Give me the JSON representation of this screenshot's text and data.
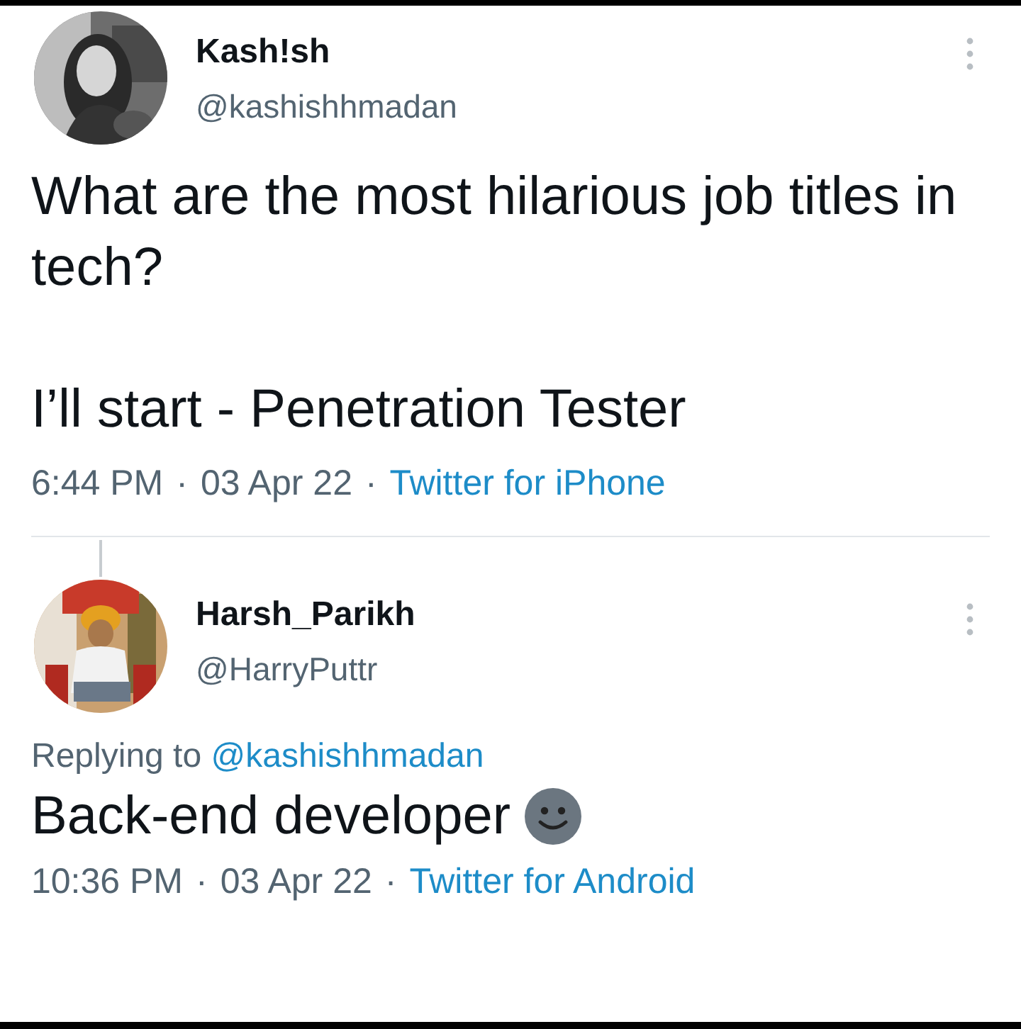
{
  "tweets": [
    {
      "name": "Kash!sh",
      "handle": "@kashishhmadan",
      "paragraphs": [
        "What are the most hilarious job titles in tech?",
        "I’ll start - Penetration Tester"
      ],
      "meta": [
        {
          "kind": "time",
          "text": "6:44 PM"
        },
        {
          "kind": "separator",
          "text": "·"
        },
        {
          "kind": "date",
          "text": "03 Apr 22"
        },
        {
          "kind": "separator",
          "text": "·"
        },
        {
          "kind": "source",
          "text": "Twitter for iPhone"
        }
      ]
    },
    {
      "name": "Harsh_Parikh",
      "handle": "@HarryPuttr",
      "replying_label": "Replying to",
      "replying_to": "@kashishhmadan",
      "paragraphs": [
        "Back-end developer"
      ],
      "meta": [
        {
          "kind": "time",
          "text": "10:36 PM"
        },
        {
          "kind": "separator",
          "text": "·"
        },
        {
          "kind": "date",
          "text": "03 Apr 22"
        },
        {
          "kind": "separator",
          "text": "·"
        },
        {
          "kind": "source",
          "text": "Twitter for Android"
        }
      ]
    }
  ]
}
